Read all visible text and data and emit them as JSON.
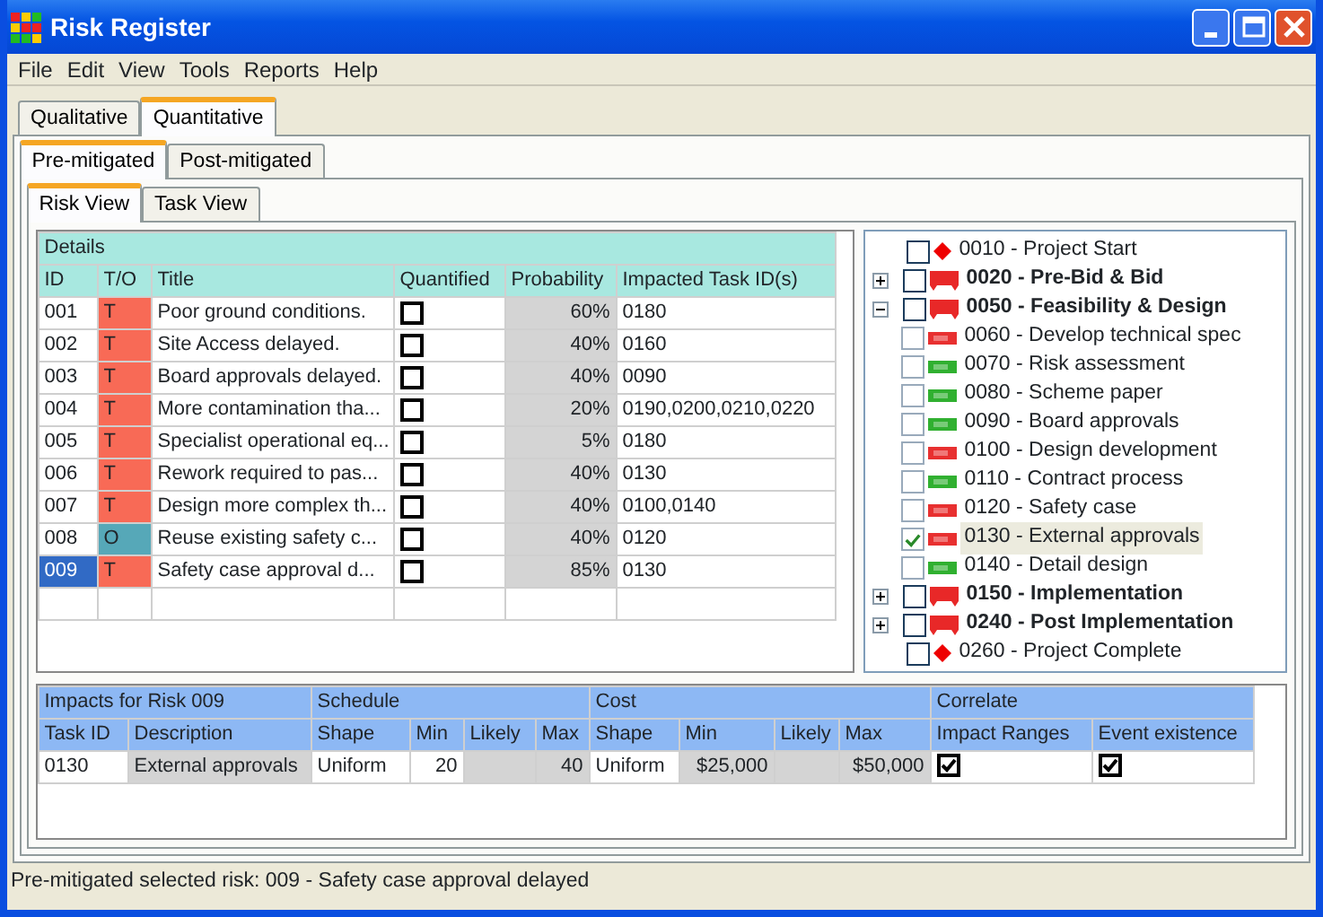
{
  "window": {
    "title": "Risk Register"
  },
  "menu": [
    "File",
    "Edit",
    "View",
    "Tools",
    "Reports",
    "Help"
  ],
  "tabs": [
    {
      "label": "Qualitative",
      "selected": false
    },
    {
      "label": "Quantitative",
      "selected": true
    }
  ],
  "sub_tabs": [
    {
      "label": "Pre-mitigated",
      "selected": true
    },
    {
      "label": "Post-mitigated",
      "selected": false
    }
  ],
  "view_tabs": [
    {
      "label": "Risk View",
      "selected": true
    },
    {
      "label": "Task View",
      "selected": false
    }
  ],
  "risk_table": {
    "group": "Details",
    "columns": [
      {
        "label": "ID"
      },
      {
        "label": "T/O"
      },
      {
        "label": "Title"
      },
      {
        "label": "Quantified"
      },
      {
        "label": "Probability",
        "readonly": true
      },
      {
        "label": "Impacted Task ID(s)"
      }
    ],
    "rows": [
      {
        "id": "001",
        "type": "T",
        "color": "#f86a56",
        "title": "Poor ground conditions.",
        "quantified": false,
        "probability": "60%",
        "tasks": "0180",
        "selected": false
      },
      {
        "id": "002",
        "type": "T",
        "color": "#f86a56",
        "title": "Site Access delayed.",
        "quantified": false,
        "probability": "40%",
        "tasks": "0160",
        "selected": false
      },
      {
        "id": "003",
        "type": "T",
        "color": "#f86a56",
        "title": "Board approvals delayed.",
        "quantified": false,
        "probability": "40%",
        "tasks": "0090",
        "selected": false
      },
      {
        "id": "004",
        "type": "T",
        "color": "#f86a56",
        "title": "More contamination tha...",
        "quantified": false,
        "probability": "20%",
        "tasks": "0190,0200,0210,0220",
        "selected": false
      },
      {
        "id": "005",
        "type": "T",
        "color": "#f86a56",
        "title": "Specialist operational eq...",
        "quantified": false,
        "probability": "5%",
        "tasks": "0180",
        "selected": false
      },
      {
        "id": "006",
        "type": "T",
        "color": "#f86a56",
        "title": "Rework required to pas...",
        "quantified": false,
        "probability": "40%",
        "tasks": "0130",
        "selected": false
      },
      {
        "id": "007",
        "type": "T",
        "color": "#f86a56",
        "title": "Design more complex th...",
        "quantified": false,
        "probability": "40%",
        "tasks": "0100,0140",
        "selected": false
      },
      {
        "id": "008",
        "type": "O",
        "color": "#56a8b8",
        "title": "Reuse existing safety c...",
        "quantified": false,
        "probability": "40%",
        "tasks": "0120",
        "selected": false
      },
      {
        "id": "009",
        "type": "T",
        "color": "#f86a56",
        "title": "Safety case approval d...",
        "quantified": false,
        "probability": "85%",
        "tasks": "0130",
        "selected": true
      }
    ]
  },
  "task_tree": [
    {
      "label": "0010 - Project Start",
      "kind": "milestone",
      "checked": false,
      "selected": false
    },
    {
      "label": "0020 - Pre-Bid & Bid",
      "kind": "summary",
      "checked": false,
      "expanded": false,
      "selected": false
    },
    {
      "label": "0050 - Feasibility & Design",
      "kind": "summary",
      "checked": false,
      "expanded": true,
      "selected": false,
      "children": [
        {
          "label": "0060 - Develop technical spec",
          "kind": "task",
          "color": "#e83030",
          "checked": false,
          "selected": false
        },
        {
          "label": "0070 - Risk assessment",
          "kind": "task",
          "color": "#30b030",
          "checked": false,
          "selected": false
        },
        {
          "label": "0080 - Scheme paper",
          "kind": "task",
          "color": "#30b030",
          "checked": false,
          "selected": false
        },
        {
          "label": "0090 - Board approvals",
          "kind": "task",
          "color": "#30b030",
          "checked": false,
          "selected": false
        },
        {
          "label": "0100 - Design development",
          "kind": "task",
          "color": "#e83030",
          "checked": false,
          "selected": false
        },
        {
          "label": "0110 - Contract process",
          "kind": "task",
          "color": "#30b030",
          "checked": false,
          "selected": false
        },
        {
          "label": "0120 - Safety case",
          "kind": "task",
          "color": "#e83030",
          "checked": false,
          "selected": false
        },
        {
          "label": "0130 - External approvals",
          "kind": "task",
          "color": "#e83030",
          "checked": true,
          "selected": true
        },
        {
          "label": "0140 - Detail design",
          "kind": "task",
          "color": "#30b030",
          "checked": false,
          "selected": false
        }
      ]
    },
    {
      "label": "0150 - Implementation",
      "kind": "summary",
      "checked": false,
      "expanded": false,
      "selected": false
    },
    {
      "label": "0240 - Post Implementation",
      "kind": "summary",
      "checked": false,
      "expanded": false,
      "selected": false
    },
    {
      "label": "0260 - Project Complete",
      "kind": "milestone",
      "checked": false,
      "selected": false
    }
  ],
  "impact_table": {
    "groups": [
      {
        "label": "Impacts for Risk 009",
        "columns": [
          {
            "label": "Task ID"
          },
          {
            "label": "Description",
            "readonly": true
          }
        ]
      },
      {
        "label": "Schedule",
        "columns": [
          {
            "label": "Shape"
          },
          {
            "label": "Min"
          },
          {
            "label": "Likely",
            "readonly": true
          },
          {
            "label": "Max",
            "readonly": true
          }
        ]
      },
      {
        "label": "Cost",
        "columns": [
          {
            "label": "Shape"
          },
          {
            "label": "Min",
            "readonly": true
          },
          {
            "label": "Likely",
            "readonly": true
          },
          {
            "label": "Max",
            "readonly": true
          }
        ]
      },
      {
        "label": "Correlate",
        "columns": [
          {
            "label": "Impact Ranges"
          },
          {
            "label": "Event existence"
          }
        ]
      }
    ],
    "rows": [
      {
        "cells": [
          {
            "kind": "text",
            "text": "0130"
          },
          {
            "kind": "text",
            "text": "External approvals"
          },
          {
            "kind": "text",
            "text": "Uniform"
          },
          {
            "kind": "number",
            "text": "20"
          },
          {
            "kind": "empty"
          },
          {
            "kind": "number",
            "text": "40"
          },
          {
            "kind": "text",
            "text": "Uniform"
          },
          {
            "kind": "number",
            "text": "$25,000"
          },
          {
            "kind": "empty"
          },
          {
            "kind": "number",
            "text": "$50,000"
          },
          {
            "kind": "check",
            "checked": true
          },
          {
            "kind": "check",
            "checked": true
          }
        ]
      }
    ]
  },
  "status_bar": "Pre-mitigated selected risk: 009 - Safety case approval delayed"
}
